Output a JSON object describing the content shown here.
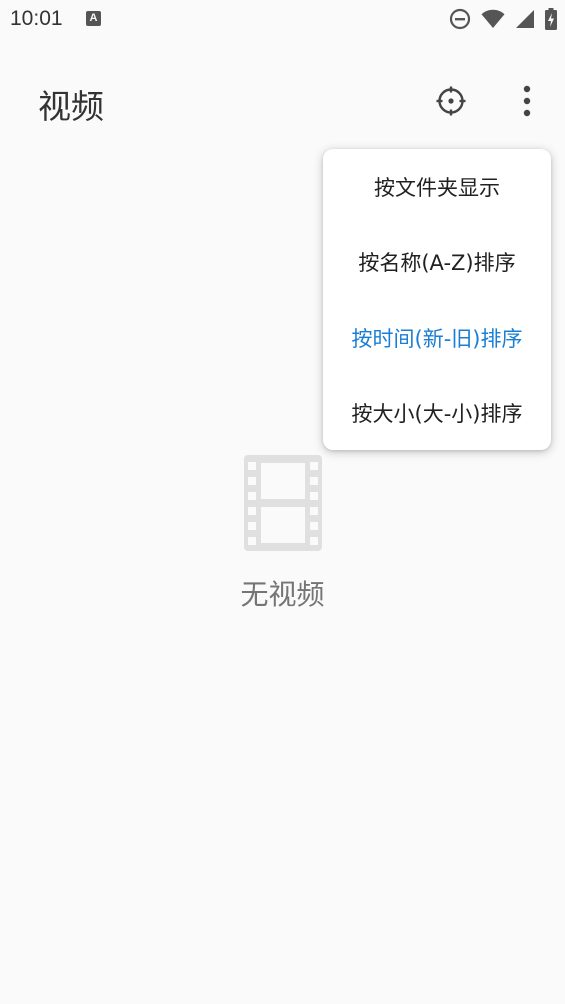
{
  "status_bar": {
    "time": "10:01",
    "notification_icon": "A"
  },
  "app_bar": {
    "title": "视频"
  },
  "menu": {
    "items": [
      {
        "label": "按文件夹显示",
        "selected": false
      },
      {
        "label": "按名称(A-Z)排序",
        "selected": false
      },
      {
        "label": "按时间(新-旧)排序",
        "selected": true
      },
      {
        "label": "按大小(大-小)排序",
        "selected": false
      }
    ],
    "selected_color": "#1a7fd4"
  },
  "empty_state": {
    "icon": "film-icon",
    "text": "无视频"
  }
}
